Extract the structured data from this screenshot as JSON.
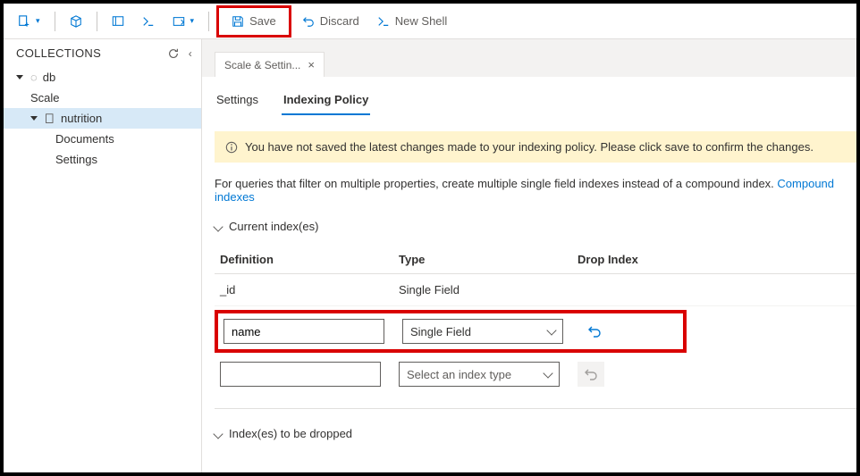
{
  "toolbar": {
    "save_label": "Save",
    "discard_label": "Discard",
    "newshell_label": "New Shell"
  },
  "sidebar": {
    "title": "COLLECTIONS",
    "db_label": "db",
    "scale_label": "Scale",
    "collection_label": "nutrition",
    "documents_label": "Documents",
    "settings_label": "Settings"
  },
  "tabs": {
    "active_label": "Scale & Settin..."
  },
  "subtabs": {
    "settings": "Settings",
    "indexing": "Indexing Policy"
  },
  "warning": "You have not saved the latest changes made to your indexing policy. Please click save to confirm the changes.",
  "description": {
    "text": "For queries that filter on multiple properties, create multiple single field indexes instead of a compound index. ",
    "link": "Compound indexes"
  },
  "sections": {
    "current": "Current index(es)",
    "dropped": "Index(es) to be dropped"
  },
  "table": {
    "col_def": "Definition",
    "col_type": "Type",
    "col_drop": "Drop Index",
    "row1_def": "_id",
    "row1_type": "Single Field",
    "row2_def": "name",
    "row2_type": "Single Field",
    "row3_def": "",
    "row3_type": "Select an index type"
  }
}
